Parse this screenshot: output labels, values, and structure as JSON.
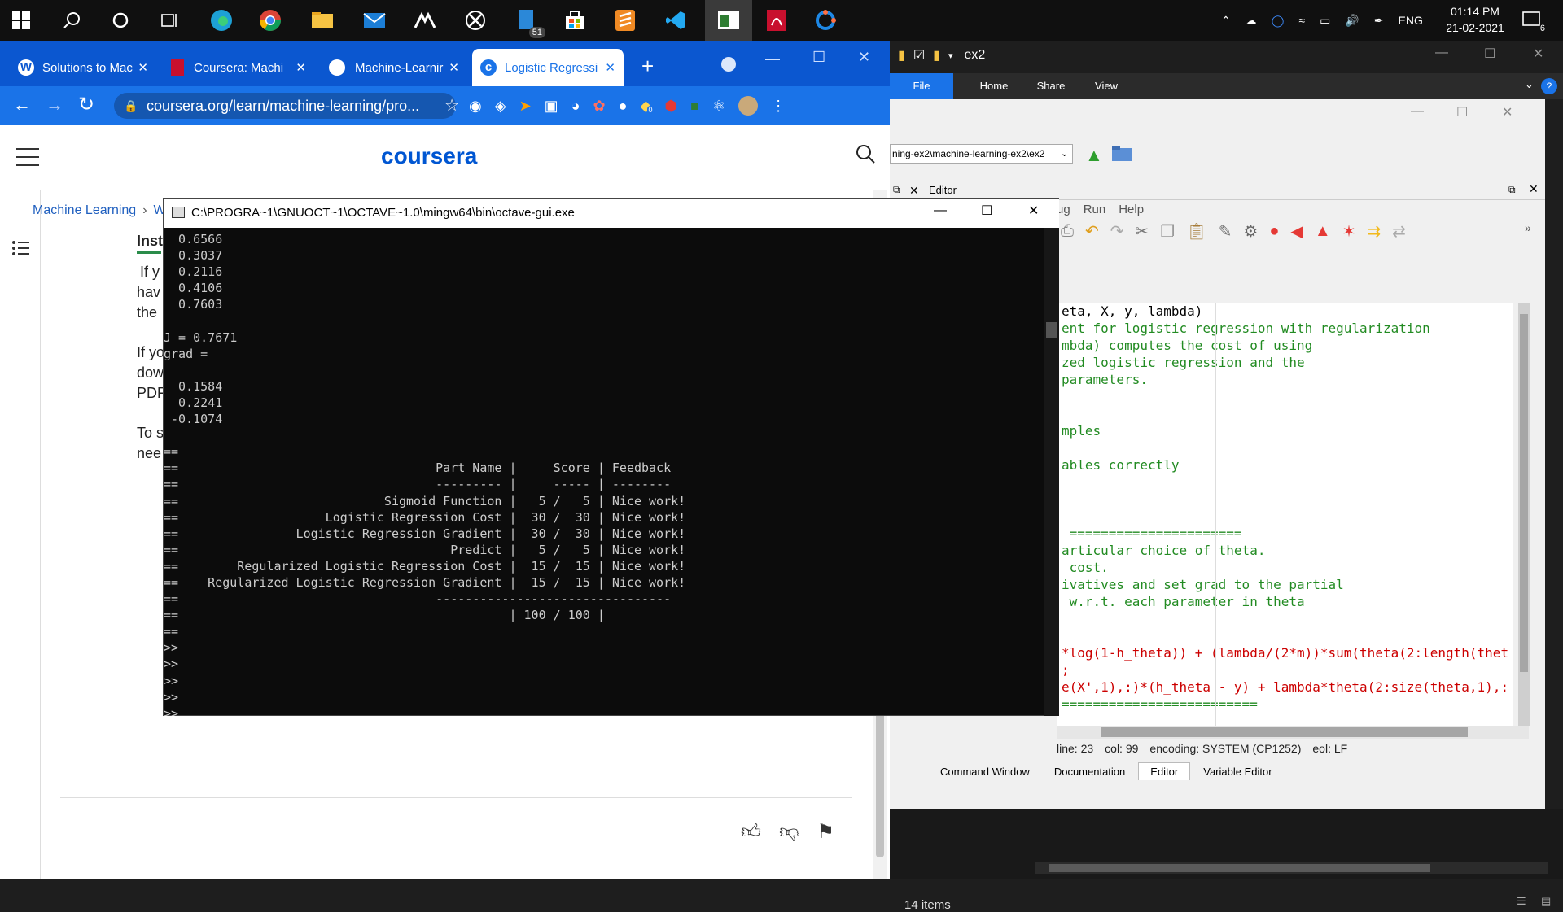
{
  "taskbar": {
    "badge_count": "51",
    "language": "ENG",
    "time": "01:14 PM",
    "date": "21-02-2021",
    "notification_count": "6"
  },
  "chrome": {
    "tabs": [
      {
        "label": "Solutions to Mac"
      },
      {
        "label": "Coursera: Machi"
      },
      {
        "label": "Machine-Learnir"
      },
      {
        "label": "Logistic Regressi"
      }
    ],
    "url": "coursera.org/learn/machine-learning/pro...",
    "ext_badge": "0",
    "brand": "coursera",
    "breadcrumb": "Machine Learning",
    "breadcrumb_next": "W",
    "body_fragments": [
      "Inst",
      "If y",
      "hav",
      "the",
      "If yo",
      "dow",
      "PDF",
      "To s",
      "nee"
    ]
  },
  "console": {
    "title": "C:\\PROGRA~1\\GNUOCT~1\\OCTAVE~1.0\\mingw64\\bin\\octave-gui.exe",
    "lines": [
      "  0.6566",
      "  0.3037",
      "  0.2116",
      "  0.4106",
      "  0.7603",
      "",
      "J = 0.7671",
      "grad =",
      "",
      "  0.1584",
      "  0.2241",
      " -0.1074",
      "",
      "==",
      "==                                   Part Name |     Score | Feedback",
      "==                                   --------- |     ----- | --------",
      "==                            Sigmoid Function |   5 /   5 | Nice work!",
      "==                    Logistic Regression Cost |  30 /  30 | Nice work!",
      "==                Logistic Regression Gradient |  30 /  30 | Nice work!",
      "==                                     Predict |   5 /   5 | Nice work!",
      "==        Regularized Logistic Regression Cost |  15 /  15 | Nice work!",
      "==    Regularized Logistic Regression Gradient |  15 /  15 | Nice work!",
      "==                                   --------------------------------",
      "==                                             | 100 / 100 |",
      "==",
      ">>",
      ">>",
      ">>",
      ">>",
      ">>"
    ]
  },
  "explorer": {
    "title": "ex2",
    "ribbon_tabs": [
      "File",
      "Home",
      "Share",
      "View"
    ],
    "path": "ning-ex2\\machine-learning-ex2\\ex2",
    "status": "14 items"
  },
  "editor": {
    "panel_title": "Editor",
    "menu": [
      "ug",
      "Run",
      "Help"
    ],
    "code": [
      {
        "cls": "blk",
        "text": "eta, X, y, lambda)"
      },
      {
        "cls": "green",
        "text": "ent for logistic regression with regularization"
      },
      {
        "cls": "green",
        "text": "mbda) computes the cost of using"
      },
      {
        "cls": "green",
        "text": "zed logistic regression and the"
      },
      {
        "cls": "green",
        "text": "parameters."
      },
      {
        "cls": "green",
        "text": ""
      },
      {
        "cls": "green",
        "text": ""
      },
      {
        "cls": "green",
        "text": "mples"
      },
      {
        "cls": "green",
        "text": ""
      },
      {
        "cls": "green",
        "text": "ables correctly"
      },
      {
        "cls": "green",
        "text": ""
      },
      {
        "cls": "green",
        "text": ""
      },
      {
        "cls": "green",
        "text": ""
      },
      {
        "cls": "green",
        "text": " ======================"
      },
      {
        "cls": "green",
        "text": "articular choice of theta."
      },
      {
        "cls": "green",
        "text": " cost."
      },
      {
        "cls": "green",
        "text": "ivatives and set grad to the partial"
      },
      {
        "cls": "green",
        "text": " w.r.t. each parameter in theta"
      },
      {
        "cls": "green",
        "text": ""
      },
      {
        "cls": "green",
        "text": ""
      },
      {
        "cls": "red",
        "text": "*log(1-h_theta)) + (lambda/(2*m))*sum(theta(2:length(thet"
      },
      {
        "cls": "red",
        "text": ";"
      },
      {
        "cls": "red",
        "text": "e(X',1),:)*(h_theta - y) + lambda*theta(2:size(theta,1),:"
      },
      {
        "cls": "green",
        "text": "========================="
      }
    ],
    "status_line": "line: 23",
    "status_col": "col: 99",
    "status_encoding": "encoding: SYSTEM (CP1252)",
    "status_eol": "eol: LF",
    "bottom_tabs": [
      "Command Window",
      "Documentation",
      "Editor",
      "Variable Editor"
    ]
  }
}
